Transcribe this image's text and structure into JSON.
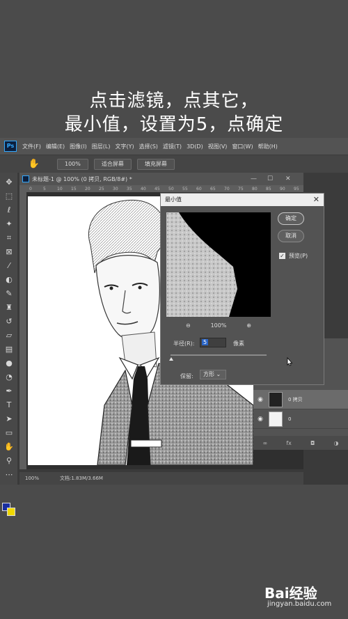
{
  "caption": {
    "line1": "点击滤镜，点其它，",
    "line2": "最小值，设置为5，点确定"
  },
  "menubar": {
    "logo": "Ps",
    "items": [
      "文件(F)",
      "编辑(E)",
      "图像(I)",
      "图层(L)",
      "文字(Y)",
      "选择(S)",
      "滤镜(T)",
      "3D(D)",
      "视图(V)",
      "窗口(W)",
      "帮助(H)"
    ]
  },
  "options": {
    "zoom_label": "100%",
    "fit_screen": "适合屏幕",
    "fill_screen": "填充屏幕"
  },
  "document": {
    "tab_title": "未标题-1 @ 100% (0 拷贝, RGB/8#) *",
    "ruler_ticks": [
      "0",
      "5",
      "10",
      "15",
      "20",
      "25",
      "30",
      "35",
      "40",
      "45",
      "50",
      "55",
      "60",
      "65",
      "70",
      "75",
      "80",
      "85",
      "90",
      "95"
    ],
    "status_zoom": "100%",
    "status_doc": "文档:1.83M/3.66M"
  },
  "layers": {
    "items": [
      {
        "name": "0 拷贝",
        "active": true
      },
      {
        "name": "0",
        "active": false
      }
    ]
  },
  "dialog": {
    "title": "最小值",
    "ok_label": "确定",
    "cancel_label": "取消",
    "preview_label": "预览(P)",
    "zoom_value": "100%",
    "radius_label": "半径(R):",
    "radius_value": "5",
    "radius_unit": "像素",
    "preserve_label": "保留:",
    "preserve_value": "方形"
  },
  "watermark": {
    "brand": "Bai经验",
    "url": "jingyan.baidu.com"
  },
  "colors": {
    "foreground": "#1a2fa0",
    "background": "#f0d800",
    "accent": "#31a8ff"
  }
}
